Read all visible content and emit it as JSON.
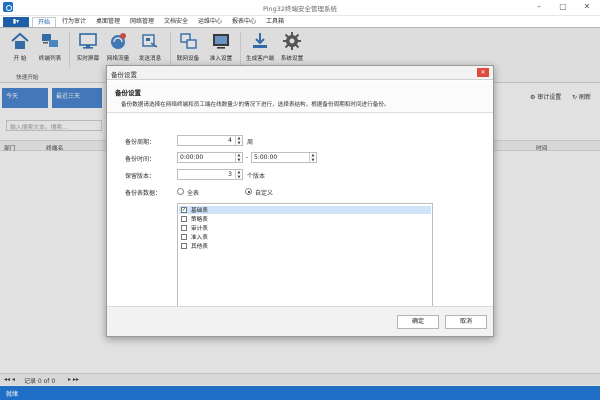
{
  "window": {
    "title": "Ping32终端安全管理系统"
  },
  "tabs": [
    {
      "label": "开始"
    },
    {
      "label": "行为审计"
    },
    {
      "label": "桌面管理"
    },
    {
      "label": "网络管理"
    },
    {
      "label": "文档安全"
    },
    {
      "label": "运维中心"
    },
    {
      "label": "报表中心"
    },
    {
      "label": "工具箱"
    }
  ],
  "file_menu_glyph": "▮▾",
  "ribbon": {
    "buttons": [
      {
        "label": "开 始",
        "icon": "home-icon"
      },
      {
        "label": "终端列表",
        "icon": "terminal-list-icon"
      },
      {
        "label": "实时屏幕",
        "icon": "monitor-icon"
      },
      {
        "label": "网络流量",
        "icon": "network-traffic-icon"
      },
      {
        "label": "发送消息",
        "icon": "send-message-icon"
      },
      {
        "label": "联网设备",
        "icon": "network-device-icon"
      },
      {
        "label": "准入设置",
        "icon": "access-settings-icon"
      },
      {
        "label": "生成客户端",
        "icon": "download-client-icon"
      },
      {
        "label": "系统设置",
        "icon": "gear-icon"
      }
    ],
    "group_label": "快速开始"
  },
  "main": {
    "date_today": "今天",
    "date_3days": "最近三天",
    "audit_settings": "审计设置",
    "refresh": "刷新",
    "search_placeholder": "输入搜索文本，搜索...",
    "columns": {
      "dept": "部门",
      "terminal": "终端名",
      "time": "时间"
    },
    "pager_text": "记录 0 of 0",
    "status": "就绪"
  },
  "dialog": {
    "title": "备份设置",
    "heading": "备份设置",
    "description": "备份数据请选择在网络终端和员工端在线数量少的情况下进行，选择表结构，根据备份周期和时间进行备份。",
    "period_label": "备份周期：",
    "period_value": "4",
    "period_unit": "周",
    "time_label": "备份时间：",
    "time_start": "0:00:00",
    "time_sep": "-",
    "time_end": "5:00:00",
    "keep_label": "保留版本：",
    "keep_value": "3",
    "keep_unit": "个版本",
    "tables_label": "备份表数据：",
    "radio_all": "全表",
    "radio_custom": "自定义",
    "selected_radio": "custom",
    "tables": [
      {
        "label": "基础表",
        "checked": true,
        "selected": true
      },
      {
        "label": "策略表",
        "checked": false,
        "selected": false
      },
      {
        "label": "审计表",
        "checked": false,
        "selected": false
      },
      {
        "label": "准入表",
        "checked": false,
        "selected": false
      },
      {
        "label": "其他表",
        "checked": false,
        "selected": false
      }
    ],
    "ok": "确定",
    "cancel": "取消"
  }
}
